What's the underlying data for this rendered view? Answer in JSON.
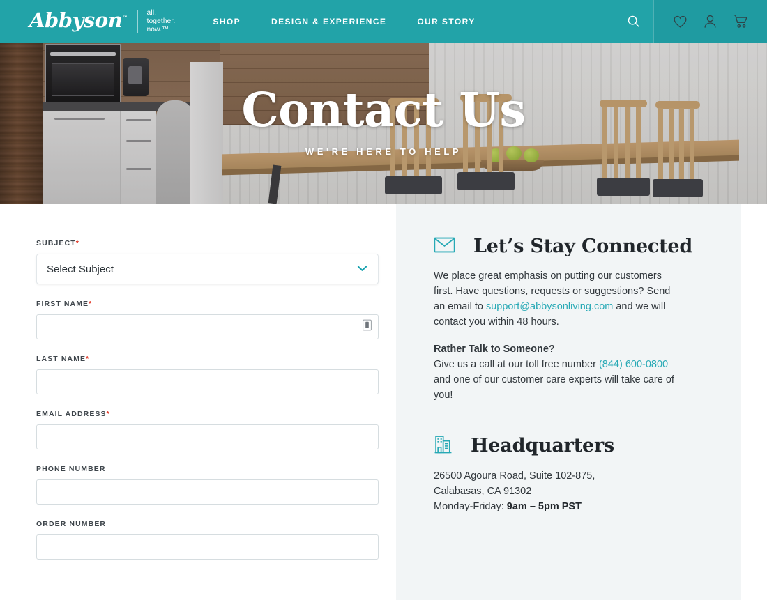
{
  "header": {
    "logo": {
      "wordmark": "Abbyson",
      "trademark": "™",
      "tagline_1": "all.",
      "tagline_2": "together.",
      "tagline_3": "now.™"
    },
    "nav": [
      {
        "label": "SHOP"
      },
      {
        "label": "DESIGN & EXPERIENCE"
      },
      {
        "label": "OUR STORY"
      }
    ],
    "icons": [
      {
        "name": "search-icon"
      },
      {
        "name": "heart-icon"
      },
      {
        "name": "account-icon"
      },
      {
        "name": "cart-icon"
      }
    ],
    "colors": {
      "bar": "#22a3a8",
      "icons_cell": "#1f9ba1"
    }
  },
  "hero": {
    "title": "Contact Us",
    "subtitle": "WE'RE HERE TO HELP"
  },
  "form": {
    "subject": {
      "label": "SUBJECT",
      "required": "*",
      "value": "Select Subject"
    },
    "fields": [
      {
        "label": "FIRST NAME",
        "required": "*",
        "value": "",
        "placeholder": ""
      },
      {
        "label": "LAST NAME",
        "required": "*",
        "value": "",
        "placeholder": ""
      },
      {
        "label": "EMAIL ADDRESS",
        "required": "*",
        "value": "",
        "placeholder": ""
      },
      {
        "label": "PHONE NUMBER",
        "required": "",
        "value": "",
        "placeholder": ""
      },
      {
        "label": "ORDER NUMBER",
        "required": "",
        "value": "",
        "placeholder": ""
      }
    ]
  },
  "info": {
    "connected": {
      "title": "Let’s Stay Connected",
      "para_1a": "We place great emphasis on putting our customers first. Have questions, requests or suggestions? Send an email to ",
      "email": "support@abbysonliving.com",
      "para_1b": " and we will contact you within 48 hours.",
      "subhead": "Rather Talk to Someone?",
      "para_2a": "Give us a call at our toll free number ",
      "phone": "(844) 600-0800",
      "para_2b": " and one of our customer care experts will take care of you!"
    },
    "headquarters": {
      "title": "Headquarters",
      "address_line_1": "26500 Agoura Road, Suite 102-875,",
      "address_line_2": "Calabasas, CA 91302",
      "hours_label": "Monday-Friday: ",
      "hours_value": "9am – 5pm PST"
    }
  },
  "colors": {
    "teal": "#22a3a8",
    "link_teal": "#27a9b5",
    "required_red": "#e0301e",
    "panel_bg": "#f2f5f6"
  }
}
